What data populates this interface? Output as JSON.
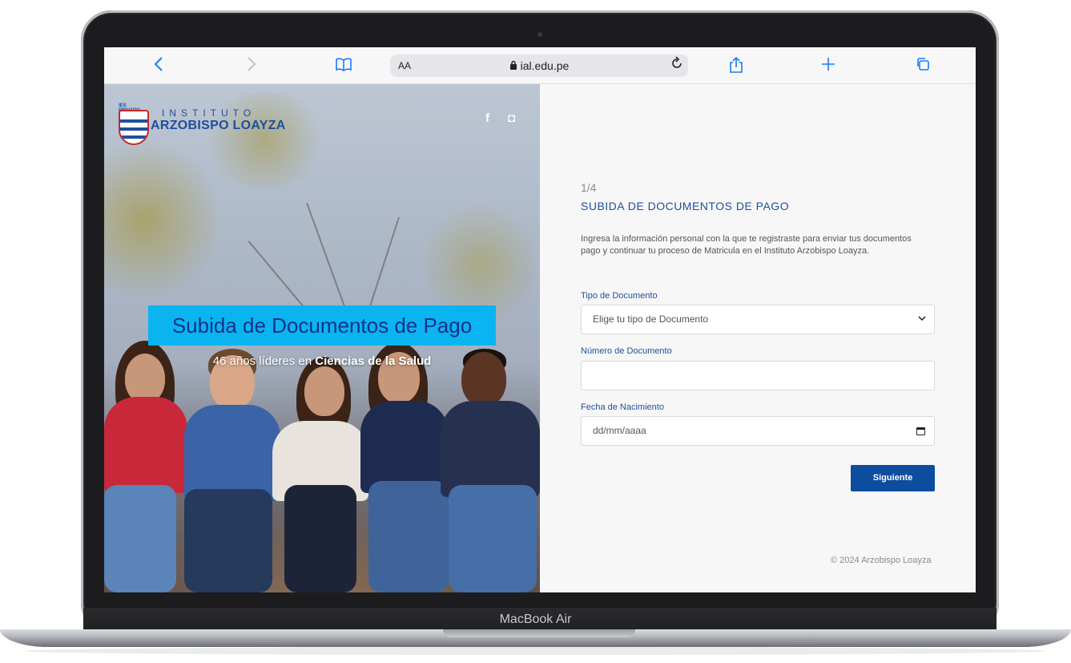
{
  "device": {
    "label": "MacBook Air"
  },
  "browser": {
    "url": "ial.edu.pe",
    "text_size_label": "AA",
    "icons": [
      "back-icon",
      "forward-icon",
      "bookmarks-icon",
      "lock-icon",
      "reload-icon",
      "share-icon",
      "new-tab-icon",
      "tabs-icon"
    ]
  },
  "hero": {
    "logo": {
      "tag": "IES PRIVADO",
      "line1": "INSTITUTO",
      "line2": "ARZOBISPO LOAYZA"
    },
    "social": {
      "facebook": "f",
      "instagram": "◘"
    },
    "banner": "Subida de Documentos de Pago",
    "subtitle_prefix": "46 años líderes en ",
    "subtitle_bold": "Ciencias de la Salud"
  },
  "form": {
    "step": "1/4",
    "title": "SUBIDA DE DOCUMENTOS DE PAGO",
    "intro": "Ingresa la información personal con la que te registraste para enviar tus documentos pago y continuar tu proceso de Matricula en el Instituto Arzobispo Loayza.",
    "doc_type": {
      "label": "Tipo de Documento",
      "value": "Elige tu tipo de Documento"
    },
    "doc_number": {
      "label": "Número de Documento",
      "value": ""
    },
    "birth_date": {
      "label": "Fecha de Nacimiento",
      "placeholder": "dd/mm/aaaa"
    },
    "submit_label": "Siguiente",
    "footer": "© 2024 Arzobispo Loayza"
  },
  "colors": {
    "brand_blue": "#1f4f9c",
    "button_blue": "#0d4d9f",
    "banner_cyan": "#0ab4f0",
    "safari_blue": "#1a7cf5"
  }
}
